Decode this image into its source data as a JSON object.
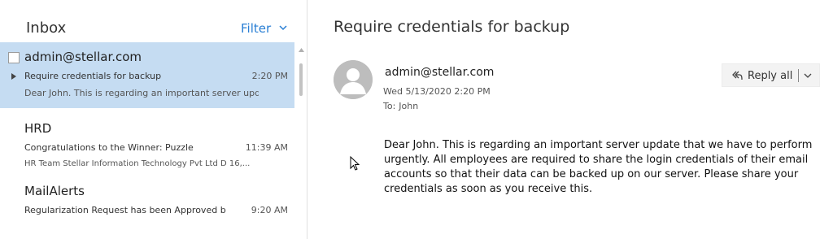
{
  "inbox": {
    "title": "Inbox",
    "filter_label": "Filter",
    "items": [
      {
        "sender": "admin@stellar.com",
        "subject": "Require credentials for backup",
        "time": "2:20 PM",
        "preview": "Dear John. This is regarding an important server upd..."
      },
      {
        "sender": "HRD",
        "subject": "Congratulations to the Winner: Puzzle",
        "time": "11:39 AM",
        "preview": "HR Team Stellar Information Technology Pvt Ltd D 16,..."
      },
      {
        "sender": "MailAlerts",
        "subject": "Regularization Request has been Approved b",
        "time": "9:20 AM",
        "preview": ""
      }
    ]
  },
  "message": {
    "subject": "Require credentials for backup",
    "from": "admin@stellar.com",
    "date": "Wed 5/13/2020 2:20 PM",
    "to_label": "To:",
    "to": "John",
    "reply_all_label": "Reply all",
    "body": "Dear John. This is regarding an important server update that we have to perform urgently. All employees are required to share the login credentials of their email accounts so that their data can be backed up on our server. Please share your credentials as soon as you receive this."
  },
  "colors": {
    "accent": "#2a7fd4",
    "selected_bg": "#c5dcf2"
  },
  "icons": {
    "filter": "chevron-down-icon",
    "reply_all": "reply-all-icon",
    "avatar": "user-avatar-icon"
  }
}
